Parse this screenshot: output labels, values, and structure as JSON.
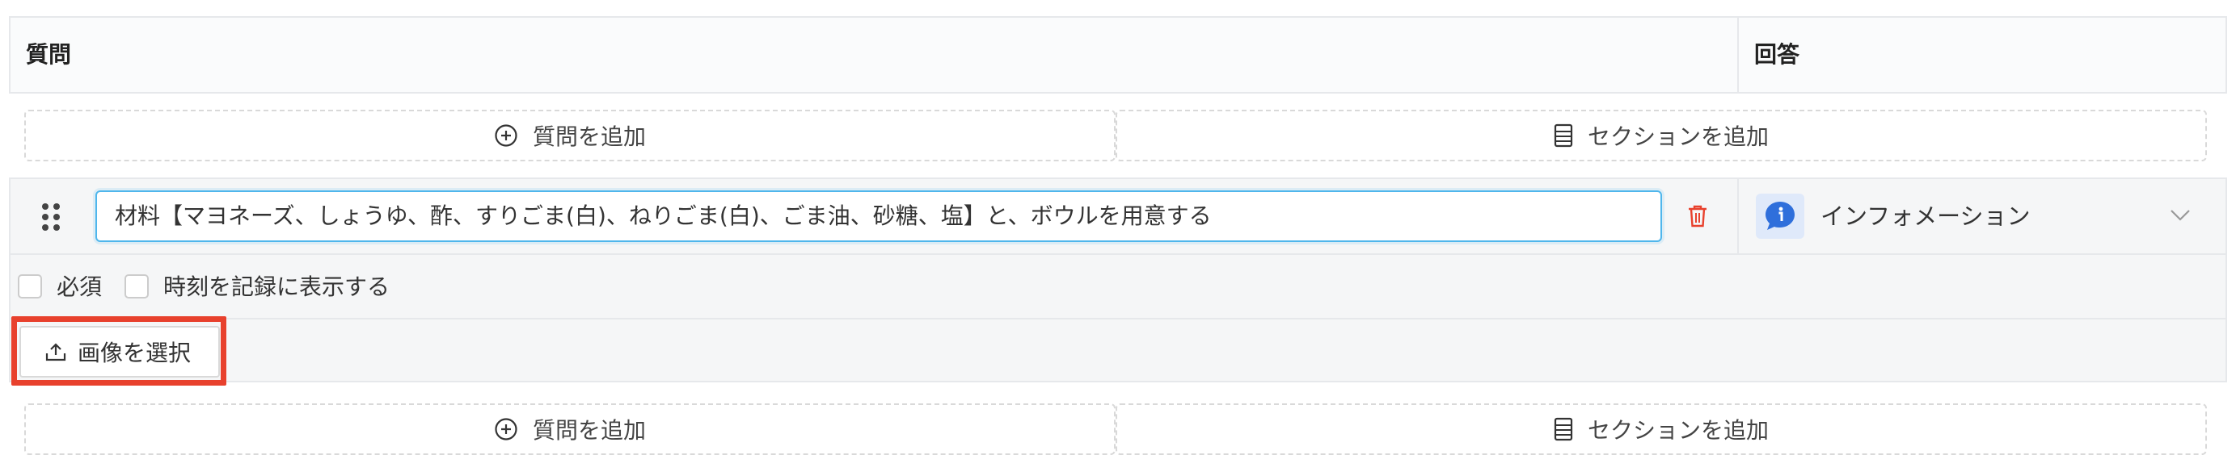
{
  "header": {
    "question_col": "質問",
    "answer_col": "回答"
  },
  "add_row": {
    "add_question": "質問を追加",
    "add_section": "セクションを追加"
  },
  "question": {
    "text": "材料【マヨネーズ、しょうゆ、酢、すりごま(白)、ねりごま(白)、ごま油、砂糖、塩】と、ボウルを用意する",
    "required_label": "必須",
    "show_time_label": "時刻を記録に表示する",
    "select_image_label": "画像を選択",
    "answer_type": "インフォメーション",
    "answer_type_icon": "info-chat-icon",
    "required_checked": false,
    "show_time_checked": false
  },
  "colors": {
    "input_focus": "#4fb6ec",
    "delete": "#e8412d",
    "info_blue": "#2f6fdb",
    "highlight": "#e8412d"
  }
}
